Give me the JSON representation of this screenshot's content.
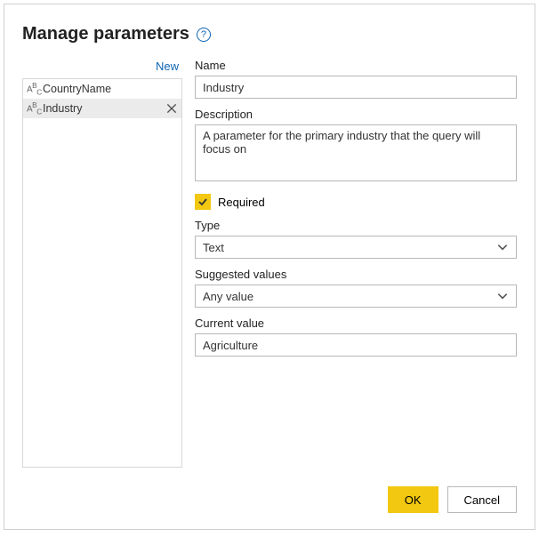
{
  "dialog": {
    "title": "Manage parameters",
    "new_link": "New"
  },
  "param_list": {
    "items": [
      {
        "label": "CountryName",
        "selected": false
      },
      {
        "label": "Industry",
        "selected": true
      }
    ]
  },
  "fields": {
    "name_label": "Name",
    "name_value": "Industry",
    "description_label": "Description",
    "description_value": "A parameter for the primary industry that the query will focus on",
    "required_label": "Required",
    "type_label": "Type",
    "type_value": "Text",
    "suggested_label": "Suggested values",
    "suggested_value": "Any value",
    "current_label": "Current value",
    "current_value": "Agriculture"
  },
  "buttons": {
    "ok": "OK",
    "cancel": "Cancel"
  }
}
